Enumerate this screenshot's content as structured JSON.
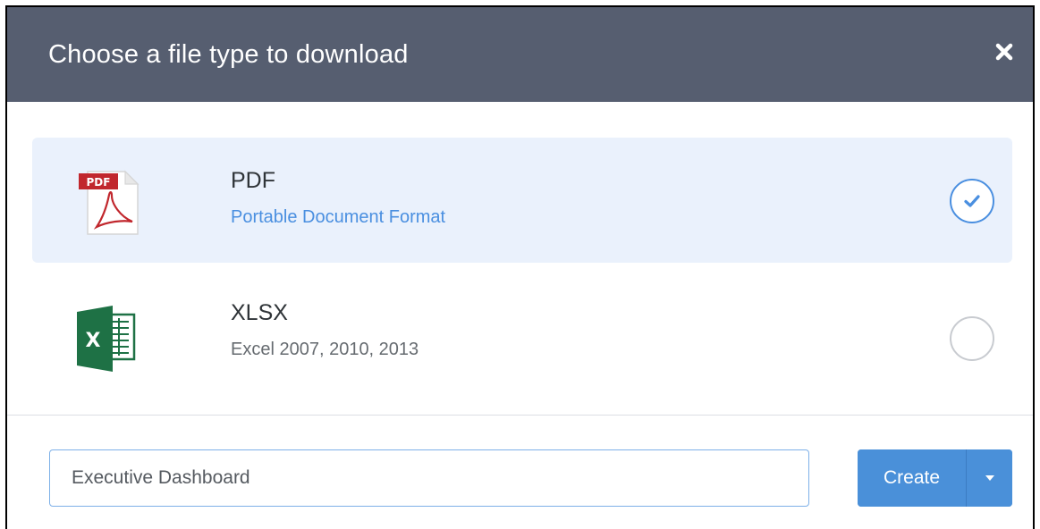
{
  "dialog": {
    "title": "Choose a file type to download",
    "close_icon": "close-icon"
  },
  "options": [
    {
      "name": "PDF",
      "description": "Portable Document Format",
      "icon": "pdf-file-icon",
      "icon_label": "PDF",
      "selected": true
    },
    {
      "name": "XLSX",
      "description": "Excel 2007, 2010, 2013",
      "icon": "excel-file-icon",
      "icon_label": "X",
      "selected": false
    }
  ],
  "footer": {
    "filename_value": "Executive Dashboard",
    "create_label": "Create",
    "caret_icon": "caret-down-icon"
  },
  "colors": {
    "header_bg": "#565e70",
    "accent": "#4a90d9",
    "selected_bg": "#eaf1fc",
    "pdf_red": "#c1272d",
    "excel_green": "#1e7145"
  }
}
